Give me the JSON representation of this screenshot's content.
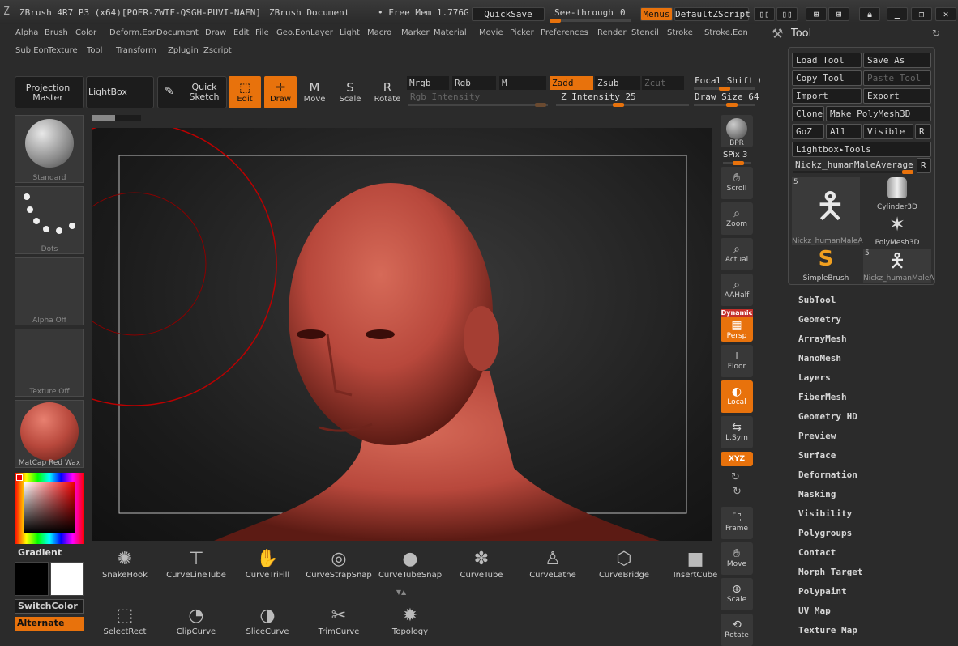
{
  "title": {
    "app": "ZBrush 4R7 P3 (x64)[POER-ZWIF-QSGH-PUVI-NAFN]",
    "document": "ZBrush Document",
    "free_mem": "• Free Mem 1.776G",
    "quicksave": "QuickSave",
    "see_through": "See-through",
    "see_through_value": "0",
    "menus": "Menus",
    "default_zscript": "DefaultZScript"
  },
  "menus": {
    "row1": [
      "Alpha",
      "Brush",
      "Color",
      "Deform.Eon",
      "Document",
      "Draw",
      "Edit",
      "File",
      "Geo.Eon",
      "Layer",
      "Light",
      "Macro",
      "Marker",
      "Material",
      "Movie",
      "Picker",
      "Preferences",
      "Render",
      "Stencil",
      "Stroke",
      "Stroke.Eon"
    ],
    "row2": [
      "Sub.Eon",
      "Texture",
      "Tool",
      "Transform",
      "Zplugin",
      "Zscript"
    ]
  },
  "shelf": {
    "projection_master": "Projection Master",
    "lightbox": "LightBox",
    "quick_sketch": "Quick Sketch",
    "edit": "Edit",
    "draw": "Draw",
    "move": "Move",
    "scale": "Scale",
    "rotate": "Rotate",
    "mrgb": "Mrgb",
    "rgb": "Rgb",
    "m": "M",
    "zadd": "Zadd",
    "zsub": "Zsub",
    "zcut": "Zcut",
    "rgb_intensity": "Rgb Intensity",
    "z_intensity": "Z Intensity 25",
    "focal_shift": "Focal Shift 0",
    "draw_size": "Draw Size 64"
  },
  "left": {
    "brush_label": "Standard",
    "stroke_label": "Dots",
    "alpha_label": "Alpha Off",
    "texture_label": "Texture Off",
    "material_label": "MatCap Red Wax",
    "gradient": "Gradient",
    "switch_color": "SwitchColor",
    "alternate": "Alternate"
  },
  "right_shelf": {
    "bpr": "BPR",
    "spix": "SPix 3",
    "scroll": "Scroll",
    "zoom": "Zoom",
    "actual": "Actual",
    "aahalf": "AAHalf",
    "dynamic": "Dynamic",
    "persp": "Persp",
    "floor": "Floor",
    "local": "Local",
    "lsym": "L.Sym",
    "xyz": "XYZ",
    "frame": "Frame",
    "move": "Move",
    "scale": "Scale",
    "rotate": "Rotate"
  },
  "bottom_shelf": {
    "row1": [
      "SnakeHook",
      "CurveLineTube",
      "CurveTriFill",
      "CurveStrapSnap",
      "CurveTubeSnap",
      "CurveTube",
      "CurveLathe",
      "CurveBridge",
      "InsertCube"
    ],
    "row2": [
      "SelectRect",
      "ClipCurve",
      "SliceCurve",
      "TrimCurve",
      "Topology"
    ]
  },
  "tool_panel": {
    "title": "Tool",
    "load_tool": "Load Tool",
    "save_as": "Save As",
    "copy_tool": "Copy Tool",
    "paste_tool": "Paste Tool",
    "import": "Import",
    "export": "Export",
    "clone": "Clone",
    "make_polymesh": "Make PolyMesh3D",
    "goz": "GoZ",
    "all": "All",
    "visible": "Visible",
    "r": "R",
    "lightbox_tools": "Lightbox▸Tools",
    "current_tool": "Nickz_humanMaleAverage",
    "thumbs": [
      {
        "label": "Nickz_humanMaleA",
        "badge": "5"
      },
      {
        "label": "Cylinder3D",
        "badge": ""
      },
      {
        "label": "PolyMesh3D",
        "badge": ""
      },
      {
        "label": "SimpleBrush",
        "badge": ""
      },
      {
        "label": "Nickz_humanMaleA",
        "badge": "5"
      }
    ]
  },
  "sections": [
    "SubTool",
    "Geometry",
    "ArrayMesh",
    "NanoMesh",
    "Layers",
    "FiberMesh",
    "Geometry HD",
    "Preview",
    "Surface",
    "Deformation",
    "Masking",
    "Visibility",
    "Polygroups",
    "Contact",
    "Morph Target",
    "Polypaint",
    "UV Map",
    "Texture Map"
  ],
  "colors": {
    "accent": "#e8720c",
    "model": "#b8483c"
  }
}
